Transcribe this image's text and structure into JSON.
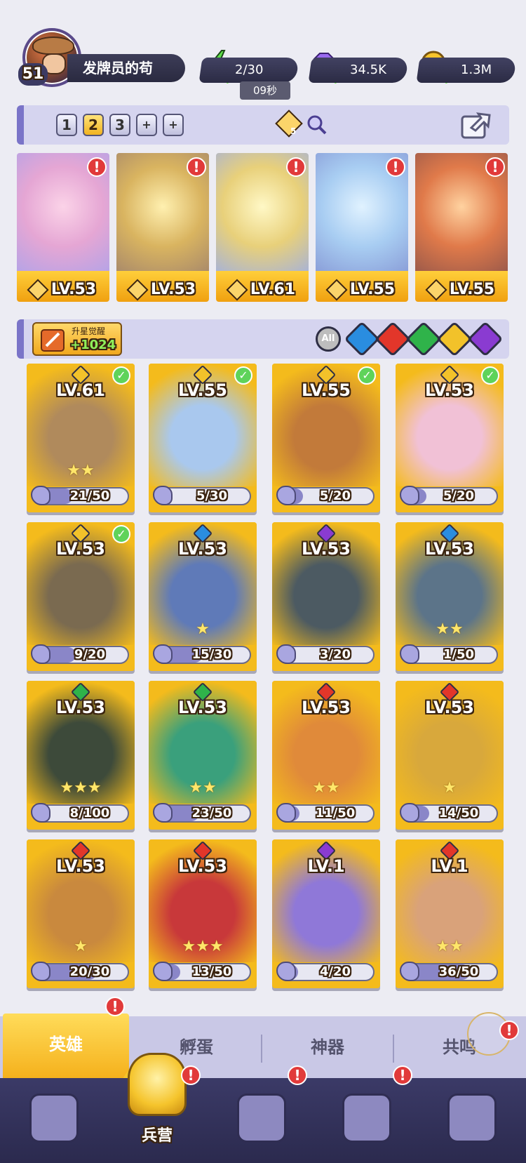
{
  "player": {
    "level": "51",
    "name": "发牌员的苟"
  },
  "resources": {
    "energy": {
      "value": "2/30",
      "timer": "09秒",
      "icon": "lightning-icon"
    },
    "gems": {
      "value": "34.5K",
      "icon": "diamond-icon"
    },
    "coins": {
      "value": "1.3M",
      "icon": "coin-icon"
    }
  },
  "team_tabs": [
    "1",
    "2",
    "3",
    "+",
    "+"
  ],
  "team_active": "2",
  "team_power_badge": "5",
  "formation": [
    {
      "level": "LV.53",
      "alert": "!"
    },
    {
      "level": "LV.53",
      "alert": "!"
    },
    {
      "level": "LV.61",
      "alert": "!"
    },
    {
      "level": "LV.55",
      "alert": "!"
    },
    {
      "level": "LV.55",
      "alert": "!"
    }
  ],
  "star_up": {
    "title": "升星觉醒",
    "value": "+1024"
  },
  "filters": {
    "all": "All",
    "elements": [
      "water",
      "fire",
      "wind",
      "light",
      "dark"
    ]
  },
  "element_colors": {
    "water": "#2a8de0",
    "fire": "#e2362a",
    "wind": "#2fb34a",
    "light": "#f2c22a",
    "dark": "#8a3bd1"
  },
  "heroes": [
    {
      "level": "LV.61",
      "progress": "21/50",
      "progress_value": 0.42,
      "element": "light",
      "owned_check": true,
      "stars": "★★",
      "art": "#b08a5c"
    },
    {
      "level": "LV.55",
      "progress": "5/30",
      "progress_value": 0.17,
      "element": "light",
      "owned_check": true,
      "stars": "",
      "art": "#a9c8ee"
    },
    {
      "level": "LV.55",
      "progress": "5/20",
      "progress_value": 0.25,
      "element": "light",
      "owned_check": true,
      "stars": "",
      "art": "#c27a3a"
    },
    {
      "level": "LV.53",
      "progress": "5/20",
      "progress_value": 0.25,
      "element": "light",
      "owned_check": true,
      "stars": "",
      "art": "#f1c1d6"
    },
    {
      "level": "LV.53",
      "progress": "9/20",
      "progress_value": 0.45,
      "element": "light",
      "owned_check": true,
      "stars": "",
      "art": "#7a6a50"
    },
    {
      "level": "LV.53",
      "progress": "15/30",
      "progress_value": 0.5,
      "element": "water",
      "owned_check": false,
      "stars": "★",
      "art": "#5f7ab8"
    },
    {
      "level": "LV.53",
      "progress": "3/20",
      "progress_value": 0.15,
      "element": "dark",
      "owned_check": false,
      "stars": "",
      "art": "#4c5a62"
    },
    {
      "level": "LV.53",
      "progress": "1/50",
      "progress_value": 0.02,
      "element": "water",
      "owned_check": false,
      "stars": "★★",
      "art": "#5c7489"
    },
    {
      "level": "LV.53",
      "progress": "8/100",
      "progress_value": 0.08,
      "element": "wind",
      "owned_check": false,
      "stars": "★★★",
      "art": "#3d4a3a"
    },
    {
      "level": "LV.53",
      "progress": "23/50",
      "progress_value": 0.46,
      "element": "wind",
      "owned_check": false,
      "stars": "★★",
      "art": "#3aa07c"
    },
    {
      "level": "LV.53",
      "progress": "11/50",
      "progress_value": 0.22,
      "element": "fire",
      "owned_check": false,
      "stars": "★★",
      "art": "#e08a3a"
    },
    {
      "level": "LV.53",
      "progress": "14/50",
      "progress_value": 0.28,
      "element": "fire",
      "owned_check": false,
      "stars": "★",
      "art": "#d8a83c"
    },
    {
      "level": "LV.53",
      "progress": "20/30",
      "progress_value": 0.67,
      "element": "fire",
      "owned_check": false,
      "stars": "★",
      "art": "#c9893e"
    },
    {
      "level": "LV.53",
      "progress": "13/50",
      "progress_value": 0.26,
      "element": "fire",
      "owned_check": false,
      "stars": "★★★",
      "art": "#c8383a"
    },
    {
      "level": "LV.1",
      "progress": "4/20",
      "progress_value": 0.2,
      "element": "dark",
      "owned_check": false,
      "stars": "",
      "art": "#8f78d8"
    },
    {
      "level": "LV.1",
      "progress": "36/50",
      "progress_value": 0.72,
      "element": "fire",
      "owned_check": false,
      "stars": "★★",
      "art": "#d9a27a"
    }
  ],
  "sub_tabs": {
    "heroes": "英雄",
    "eggs": "孵蛋",
    "artifacts": "神器",
    "resonance": "共鸣"
  },
  "alert_mark": "!",
  "nav": {
    "active_label": "兵营",
    "items": [
      {
        "icon": "cards-icon"
      },
      {
        "icon": "barracks-icon",
        "label": "兵营"
      },
      {
        "icon": "map-book-icon"
      },
      {
        "icon": "temple-icon"
      },
      {
        "icon": "mushroom-icon"
      }
    ]
  }
}
